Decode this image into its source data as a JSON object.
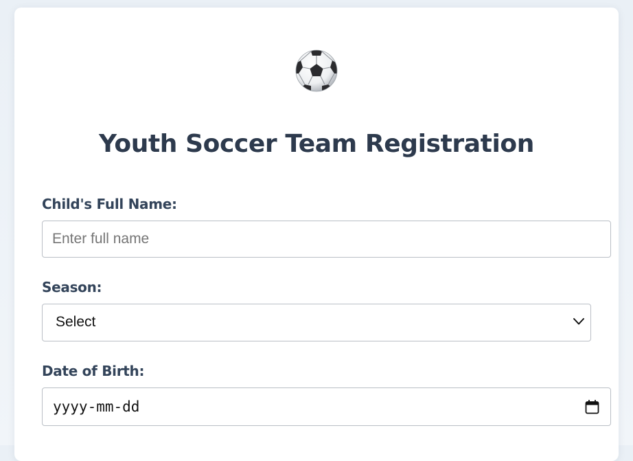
{
  "form": {
    "logo_icon": "soccer-ball-icon",
    "title": "Youth Soccer Team Registration",
    "fields": {
      "name": {
        "label": "Child's Full Name:",
        "placeholder": "Enter full name",
        "value": ""
      },
      "season": {
        "label": "Season:",
        "selected": "Select",
        "icon": "chevron-down-icon"
      },
      "dob": {
        "label": "Date of Birth:",
        "placeholder": "yyyy-mm-dd",
        "icon": "calendar-icon"
      }
    }
  },
  "colors": {
    "background": "#eaf0f6",
    "card": "#ffffff",
    "title": "#2d3a4d",
    "label": "#33445a",
    "border": "#b9bec5",
    "placeholder": "#757575"
  }
}
